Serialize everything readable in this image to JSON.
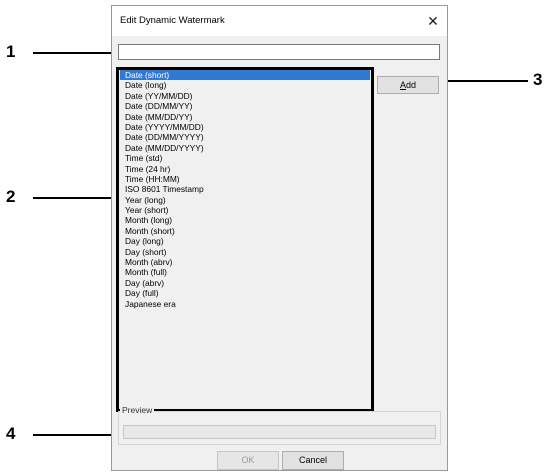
{
  "dialog": {
    "title": "Edit Dynamic Watermark",
    "close_symbol": "✕",
    "input_value": "",
    "list_items": [
      "Date (short)",
      "Date (long)",
      "Date (YY/MM/DD)",
      "Date (DD/MM/YY)",
      "Date (MM/DD/YY)",
      "Date (YYYY/MM/DD)",
      "Date (DD/MM/YYYY)",
      "Date (MM/DD/YYYY)",
      "Time (std)",
      "Time (24 hr)",
      "Time (HH:MM)",
      "ISO 8601 Timestamp",
      "Year (long)",
      "Year (short)",
      "Month (long)",
      "Month (short)",
      "Day (long)",
      "Day (short)",
      "Month (abrv)",
      "Month (full)",
      "Day (abrv)",
      "Day (full)",
      "Japanese era"
    ],
    "selected_index": 0,
    "add_label_accel": "A",
    "add_label_rest": "dd",
    "preview_label": "Preview",
    "preview_value": "",
    "ok_label": "OK",
    "cancel_label": "Cancel"
  },
  "callouts": [
    "1",
    "2",
    "3",
    "4"
  ]
}
